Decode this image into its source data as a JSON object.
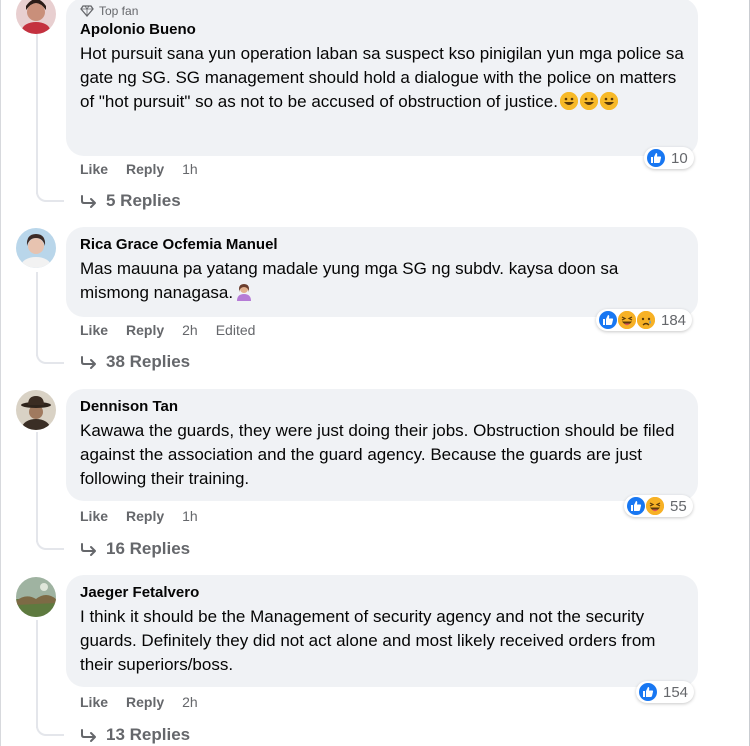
{
  "comments": [
    {
      "badge": "Top fan",
      "author": "Apolonio Bueno",
      "text": "Hot pursuit sana yun operation laban sa suspect kso pinigilan yun mga police sa gate ng SG. SG management should hold a dialogue with the police on matters of \"hot pursuit\" so as not to be accused of obstruction of justice.",
      "like": "Like",
      "reply": "Reply",
      "time": "1h",
      "edited": "",
      "reactions": [
        "like"
      ],
      "reaction_count": "10",
      "replies": "5 Replies"
    },
    {
      "author": "Rica Grace Ocfemia Manuel",
      "text": "Mas mauuna pa yatang madale yung mga SG ng subdv. kaysa doon sa mismong nanagasa.",
      "like": "Like",
      "reply": "Reply",
      "time": "2h",
      "edited": "Edited",
      "reactions": [
        "like",
        "haha",
        "sad"
      ],
      "reaction_count": "184",
      "replies": "38 Replies"
    },
    {
      "author": "Dennison Tan",
      "text": "Kawawa the guards, they were just doing their jobs. Obstruction should be filed against the association and the guard agency. Because the guards are just following their training.",
      "like": "Like",
      "reply": "Reply",
      "time": "1h",
      "edited": "",
      "reactions": [
        "like",
        "haha"
      ],
      "reaction_count": "55",
      "replies": "16 Replies"
    },
    {
      "author": "Jaeger Fetalvero",
      "text": "I think it should be the Management of security agency and not the security guards. Definitely they did not act alone and most likely received orders from their superiors/boss.",
      "like": "Like",
      "reply": "Reply",
      "time": "2h",
      "edited": "",
      "reactions": [
        "like"
      ],
      "reaction_count": "154",
      "replies": "13 Replies"
    }
  ],
  "colors": {
    "bubble": "#f0f2f5",
    "like_blue": "#1877f2",
    "meta_gray": "#65676b",
    "emoji_yellow": "#f7b928"
  },
  "icons": {
    "badge": "diamond-icon",
    "replies": "reply-arrow-icon",
    "like_reaction": "thumbs-up-icon",
    "haha_reaction": "laughing-face-icon",
    "sad_reaction": "crying-face-icon",
    "grin_emoji": "grinning-face-icon",
    "person_emoji": "person-gesturing-icon"
  }
}
